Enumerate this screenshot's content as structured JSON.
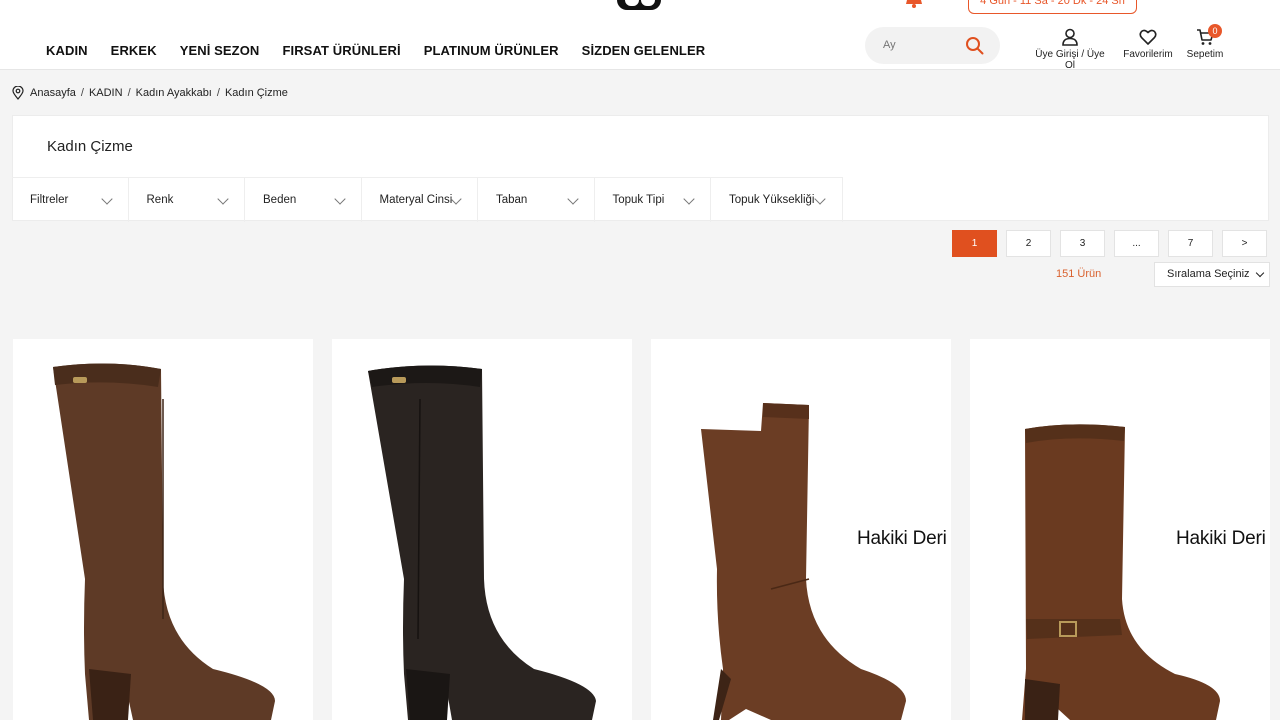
{
  "header": {
    "countdown": "4 Gün - 11 Sa - 20 Dk - 24 Sn",
    "nav": [
      "KADIN",
      "ERKEK",
      "YENİ SEZON",
      "FIRSAT ÜRÜNLERİ",
      "PLATINUM ÜRÜNLER",
      "SİZDEN GELENLER"
    ],
    "search_placeholder": "Ay",
    "account_label": "Üye Girişi / Üye Ol",
    "favorites_label": "Favorilerim",
    "cart_label": "Sepetim",
    "cart_count": "0"
  },
  "breadcrumb": [
    "Anasayfa",
    "KADIN",
    "Kadın Ayakkabı",
    "Kadın Çizme"
  ],
  "page": {
    "title": "Kadın Çizme",
    "filters": [
      "Filtreler",
      "Renk",
      "Beden",
      "Materyal Cinsi",
      "Taban",
      "Topuk Tipi",
      "Topuk Yüksekliği"
    ],
    "pagination": [
      "1",
      "2",
      "3",
      "...",
      "7",
      ">"
    ],
    "active_page": "1",
    "product_count": "151 Ürün",
    "sort_label": "Sıralama Seçiniz"
  },
  "products": [
    {
      "badge": "",
      "color": "#5e3a26"
    },
    {
      "badge": "",
      "color": "#2a2421"
    },
    {
      "badge": "Hakiki Deri",
      "color": "#6b3d24"
    },
    {
      "badge": "Hakiki Deri",
      "color": "#6a3a20"
    }
  ],
  "colors": {
    "accent": "#e0501f"
  }
}
